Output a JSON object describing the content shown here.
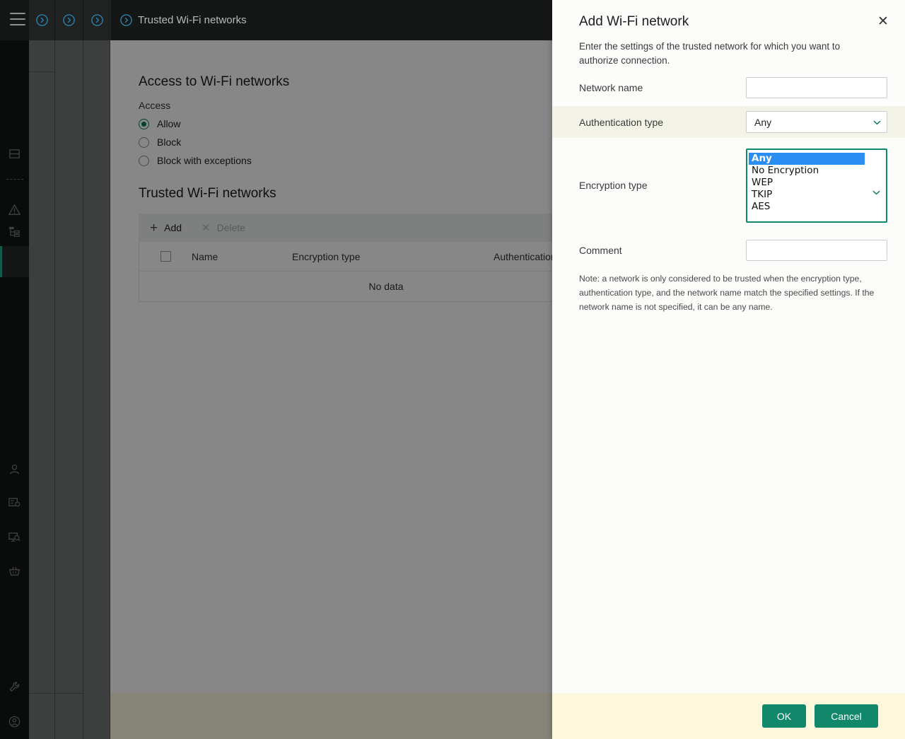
{
  "topbar": {
    "menu_icon": "hamburger-icon",
    "breadcrumb_icons": [
      "chevron-circle-right-icon",
      "chevron-circle-right-icon",
      "chevron-circle-right-icon",
      "chevron-circle-right-icon"
    ],
    "title": "Trusted Wi-Fi networks"
  },
  "sidebar": {
    "icons": [
      {
        "name": "server-icon"
      },
      {
        "name": "warning-triangle-icon"
      },
      {
        "name": "hierarchy-icon"
      },
      {
        "name": "user-icon"
      },
      {
        "name": "form-settings-icon"
      },
      {
        "name": "monitor-search-icon"
      },
      {
        "name": "basket-icon"
      },
      {
        "name": "wrench-icon"
      },
      {
        "name": "user-circle-icon"
      }
    ]
  },
  "main": {
    "section_access_title": "Access to Wi-Fi networks",
    "access_label": "Access",
    "access_options": [
      {
        "label": "Allow",
        "selected": true
      },
      {
        "label": "Block",
        "selected": false
      },
      {
        "label": "Block with exceptions",
        "selected": false
      }
    ],
    "section_trusted_title": "Trusted Wi-Fi networks",
    "toolbar": {
      "add_label": "Add",
      "add_icon": "plus-icon",
      "delete_label": "Delete",
      "delete_icon": "cross-icon"
    },
    "table": {
      "columns": [
        "Name",
        "Encryption type",
        "Authentication type"
      ],
      "select_all_icon": "checkbox-icon",
      "rows": [],
      "empty_text": "No data"
    }
  },
  "modal": {
    "title": "Add Wi-Fi network",
    "close_icon": "close-icon",
    "description": "Enter the settings of the trusted network for which you want to authorize connection.",
    "fields": {
      "network_name": {
        "label": "Network name",
        "value": "",
        "placeholder": ""
      },
      "authentication_type": {
        "label": "Authentication type",
        "value": "Any",
        "chevron_icon": "chevron-down-icon"
      },
      "encryption_type": {
        "label": "Encryption type",
        "value": "Any",
        "chevron_icon": "chevron-down-icon",
        "options": [
          "Any",
          "No Encryption",
          "WEP",
          "TKIP",
          "AES"
        ],
        "selected_option": "Any",
        "expanded": true
      },
      "comment": {
        "label": "Comment",
        "value": "",
        "placeholder": ""
      }
    },
    "note": "Note: a network is only considered to be trusted when the encryption type, authentication type, and the network name match the specified settings. If the network name is not specified, it can be any name.",
    "buttons": {
      "ok": "OK",
      "cancel": "Cancel"
    }
  },
  "colors": {
    "accent_green": "#12886b",
    "highlight_blue": "#2a8df2",
    "breadcrumb_blue": "#2d7fa8",
    "modal_footer": "#fdf8dc",
    "row_highlight": "#f3f3e8"
  }
}
